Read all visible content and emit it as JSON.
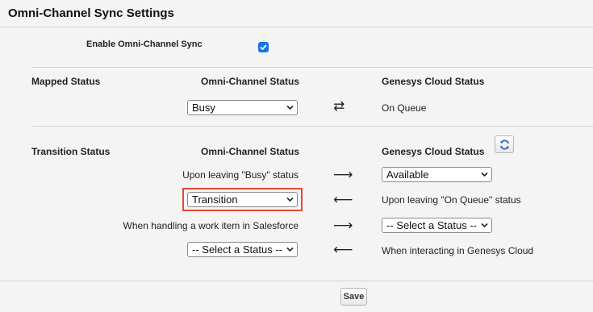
{
  "header": {
    "title": "Omni-Channel Sync Settings"
  },
  "enable": {
    "label": "Enable Omni-Channel Sync",
    "checked": true
  },
  "mapped": {
    "section_label": "Mapped Status",
    "omni_header": "Omni-Channel Status",
    "genesys_header": "Genesys Cloud Status",
    "omni_select_value": "Busy",
    "genesys_status": "On Queue",
    "arrow": "⇄"
  },
  "transition": {
    "section_label": "Transition Status",
    "omni_header": "Omni-Channel Status",
    "genesys_header": "Genesys Cloud Status",
    "rows": [
      {
        "left_text": "Upon leaving \"Busy\" status",
        "arrow": "⟶",
        "right_select": "Available"
      },
      {
        "left_select": "Transition",
        "arrow": "⟵",
        "right_text": "Upon leaving \"On Queue\" status"
      },
      {
        "left_text": "When handling a work item in Salesforce",
        "arrow": "⟶",
        "right_select": "-- Select a Status --"
      },
      {
        "left_select": "-- Select a Status --",
        "arrow": "⟵",
        "right_text": "When interacting in Genesys Cloud"
      }
    ]
  },
  "footer": {
    "save_label": "Save"
  },
  "colors": {
    "highlight": "#e24a37",
    "checkbox": "#1a73e8"
  }
}
